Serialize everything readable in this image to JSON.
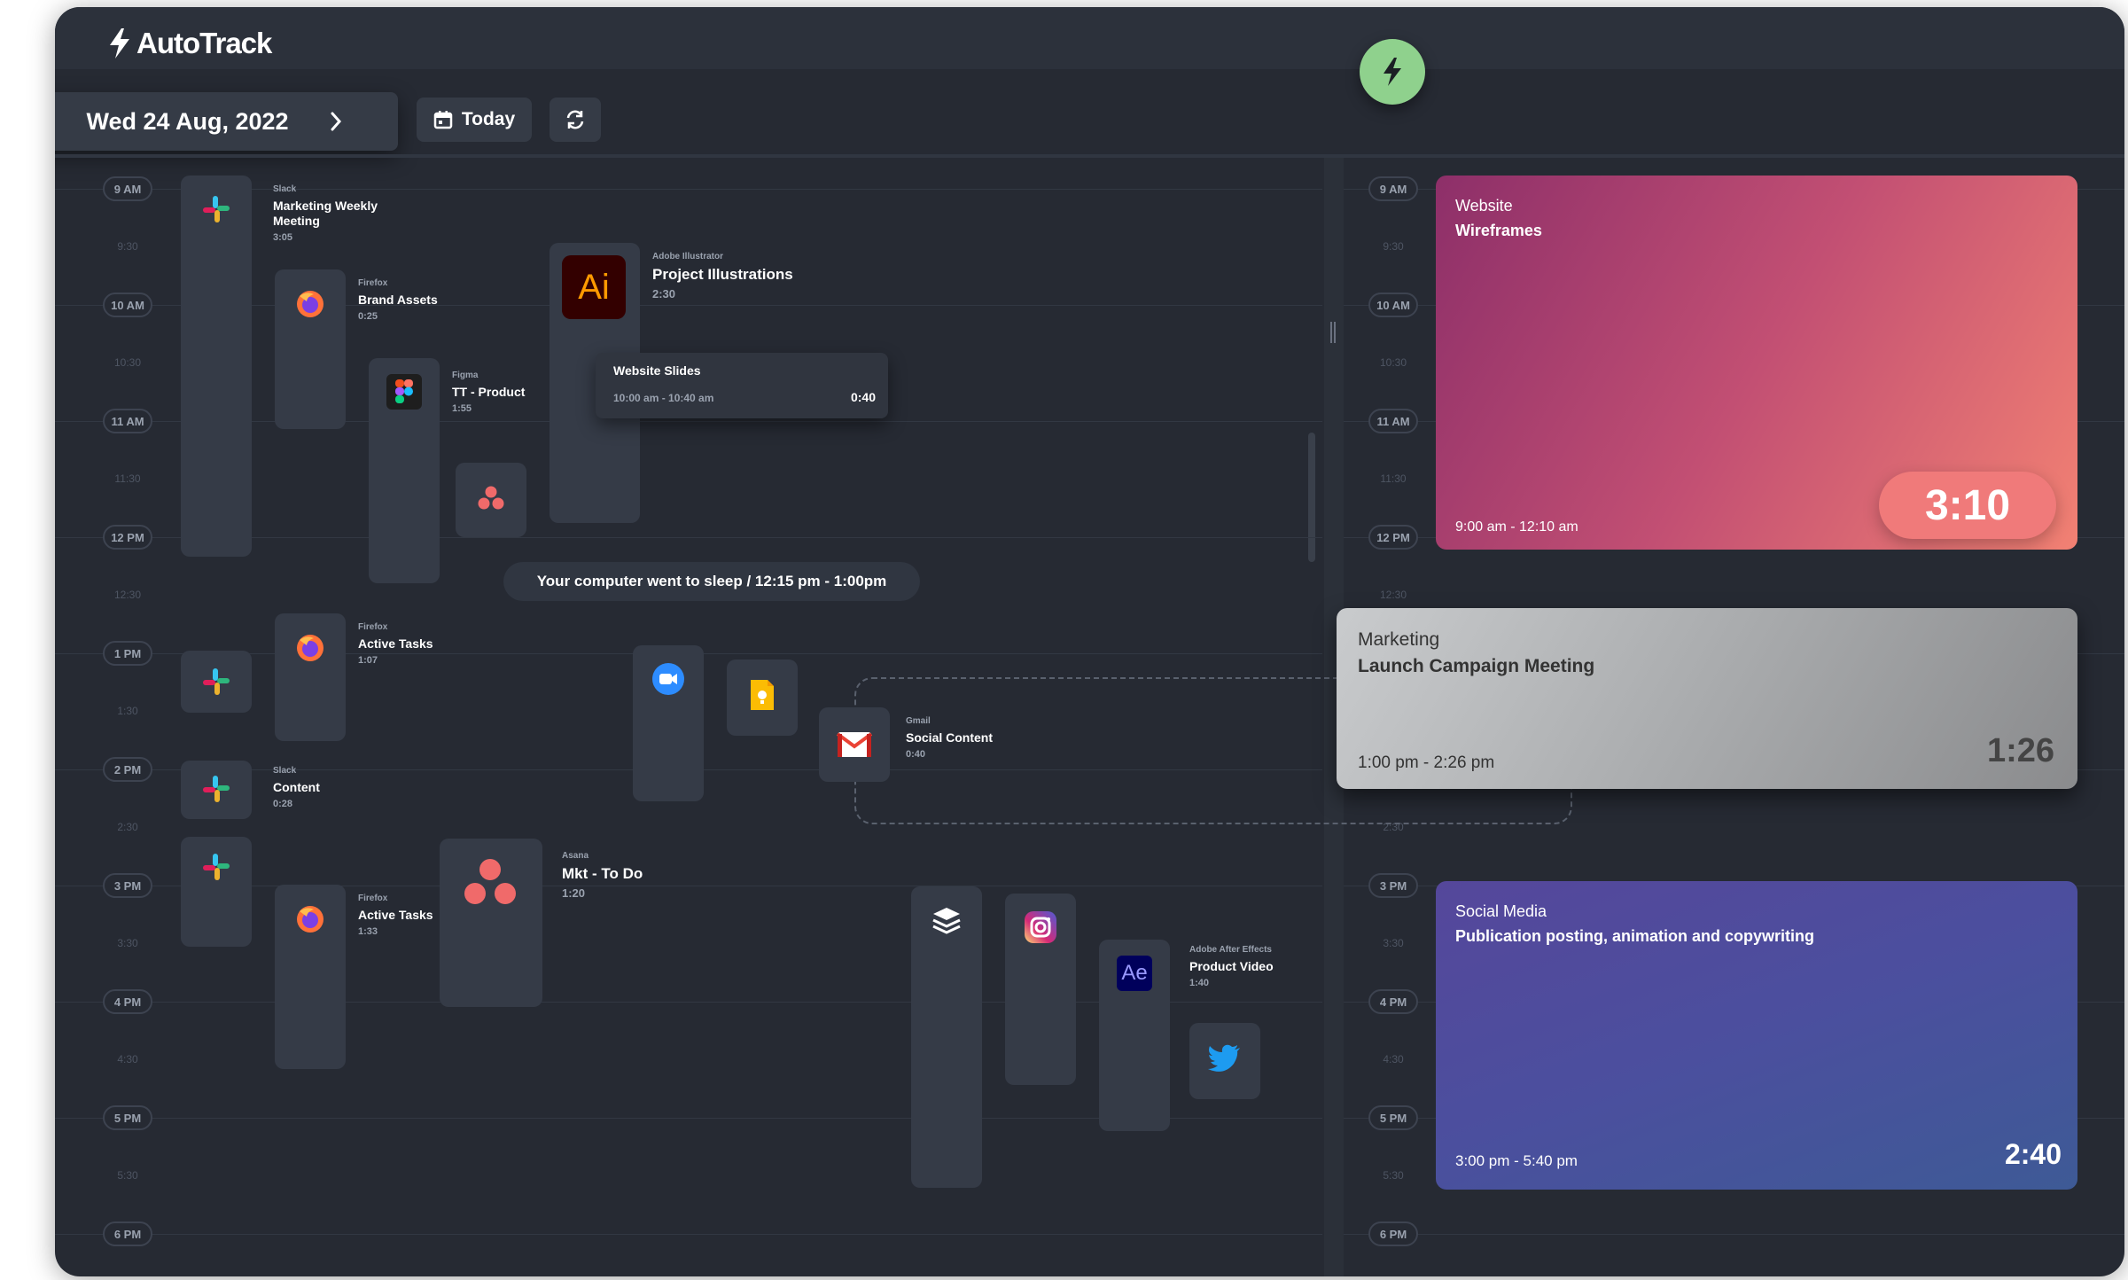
{
  "app": {
    "name": "AutoTrack"
  },
  "toolbar": {
    "date": "Wed 24 Aug, 2022",
    "today_label": "Today"
  },
  "timeline": {
    "hours": [
      "9 AM",
      "10 AM",
      "11 AM",
      "12 PM",
      "1 PM",
      "2 PM",
      "3 PM",
      "4 PM",
      "5 PM",
      "6 PM"
    ],
    "halves": [
      "9:30",
      "10:30",
      "11:30",
      "12:30",
      "1:30",
      "2:30",
      "3:30",
      "4:30",
      "5:30"
    ]
  },
  "activities": {
    "slack_marketing": {
      "app": "Slack",
      "title": "Marketing Weekly Meeting",
      "duration": "3:05"
    },
    "firefox_brand": {
      "app": "Firefox",
      "title": "Brand Assets",
      "duration": "0:25"
    },
    "figma_tt": {
      "app": "Figma",
      "title": "TT - Product",
      "duration": "1:55"
    },
    "ai_project": {
      "app": "Adobe Illustrator",
      "title": "Project Illustrations",
      "duration": "2:30",
      "icon_text": "Ai"
    },
    "firefox_active1": {
      "app": "Firefox",
      "title": "Active Tasks",
      "duration": "1:07"
    },
    "slack_content": {
      "app": "Slack",
      "title": "Content",
      "duration": "0:28"
    },
    "gmail_social": {
      "app": "Gmail",
      "title": "Social Content",
      "duration": "0:40"
    },
    "firefox_active2": {
      "app": "Firefox",
      "title": "Active Tasks",
      "duration": "1:33"
    },
    "asana_mkt": {
      "app": "Asana",
      "title": "Mkt - To Do",
      "duration": "1:20"
    },
    "ae_product": {
      "app": "Adobe After Effects",
      "title": "Product Video",
      "duration": "1:40",
      "icon_text": "Ae"
    }
  },
  "popover": {
    "title": "Website Slides",
    "time": "10:00 am - 10:40 am",
    "duration": "0:40"
  },
  "sleep_notice": "Your computer went to sleep / 12:15 pm - 1:00pm",
  "projects": [
    {
      "category": "Website",
      "title": "Wireframes",
      "time": "9:00 am - 12:10 am",
      "duration": "3:10"
    },
    {
      "category": "Marketing",
      "title": "Launch Campaign Meeting",
      "time": "1:00 pm - 2:26 pm",
      "duration": "1:26"
    },
    {
      "category": "Social Media",
      "title": "Publication posting, animation and copywriting",
      "time": "3:00 pm - 5:40 pm",
      "duration": "2:40"
    }
  ],
  "colors": {
    "background": "#262a33",
    "card": "#353b47",
    "accent_green": "#8fd18d",
    "website_grad": [
      "#8f2f6a",
      "#f07a72"
    ],
    "social_grad": [
      "#4e4aa3",
      "#3f5897"
    ]
  }
}
